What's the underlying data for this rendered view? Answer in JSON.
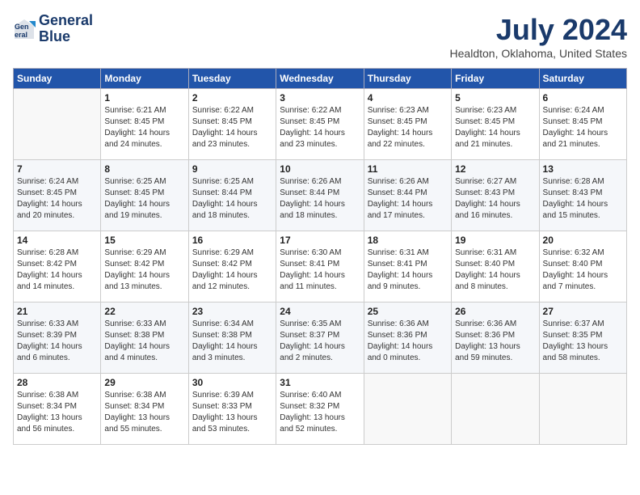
{
  "logo": {
    "line1": "General",
    "line2": "Blue"
  },
  "title": "July 2024",
  "location": "Healdton, Oklahoma, United States",
  "weekdays": [
    "Sunday",
    "Monday",
    "Tuesday",
    "Wednesday",
    "Thursday",
    "Friday",
    "Saturday"
  ],
  "weeks": [
    [
      {
        "day": "",
        "empty": true
      },
      {
        "day": "1",
        "sunrise": "Sunrise: 6:21 AM",
        "sunset": "Sunset: 8:45 PM",
        "daylight": "Daylight: 14 hours and 24 minutes."
      },
      {
        "day": "2",
        "sunrise": "Sunrise: 6:22 AM",
        "sunset": "Sunset: 8:45 PM",
        "daylight": "Daylight: 14 hours and 23 minutes."
      },
      {
        "day": "3",
        "sunrise": "Sunrise: 6:22 AM",
        "sunset": "Sunset: 8:45 PM",
        "daylight": "Daylight: 14 hours and 23 minutes."
      },
      {
        "day": "4",
        "sunrise": "Sunrise: 6:23 AM",
        "sunset": "Sunset: 8:45 PM",
        "daylight": "Daylight: 14 hours and 22 minutes."
      },
      {
        "day": "5",
        "sunrise": "Sunrise: 6:23 AM",
        "sunset": "Sunset: 8:45 PM",
        "daylight": "Daylight: 14 hours and 21 minutes."
      },
      {
        "day": "6",
        "sunrise": "Sunrise: 6:24 AM",
        "sunset": "Sunset: 8:45 PM",
        "daylight": "Daylight: 14 hours and 21 minutes."
      }
    ],
    [
      {
        "day": "7",
        "sunrise": "Sunrise: 6:24 AM",
        "sunset": "Sunset: 8:45 PM",
        "daylight": "Daylight: 14 hours and 20 minutes."
      },
      {
        "day": "8",
        "sunrise": "Sunrise: 6:25 AM",
        "sunset": "Sunset: 8:45 PM",
        "daylight": "Daylight: 14 hours and 19 minutes."
      },
      {
        "day": "9",
        "sunrise": "Sunrise: 6:25 AM",
        "sunset": "Sunset: 8:44 PM",
        "daylight": "Daylight: 14 hours and 18 minutes."
      },
      {
        "day": "10",
        "sunrise": "Sunrise: 6:26 AM",
        "sunset": "Sunset: 8:44 PM",
        "daylight": "Daylight: 14 hours and 18 minutes."
      },
      {
        "day": "11",
        "sunrise": "Sunrise: 6:26 AM",
        "sunset": "Sunset: 8:44 PM",
        "daylight": "Daylight: 14 hours and 17 minutes."
      },
      {
        "day": "12",
        "sunrise": "Sunrise: 6:27 AM",
        "sunset": "Sunset: 8:43 PM",
        "daylight": "Daylight: 14 hours and 16 minutes."
      },
      {
        "day": "13",
        "sunrise": "Sunrise: 6:28 AM",
        "sunset": "Sunset: 8:43 PM",
        "daylight": "Daylight: 14 hours and 15 minutes."
      }
    ],
    [
      {
        "day": "14",
        "sunrise": "Sunrise: 6:28 AM",
        "sunset": "Sunset: 8:42 PM",
        "daylight": "Daylight: 14 hours and 14 minutes."
      },
      {
        "day": "15",
        "sunrise": "Sunrise: 6:29 AM",
        "sunset": "Sunset: 8:42 PM",
        "daylight": "Daylight: 14 hours and 13 minutes."
      },
      {
        "day": "16",
        "sunrise": "Sunrise: 6:29 AM",
        "sunset": "Sunset: 8:42 PM",
        "daylight": "Daylight: 14 hours and 12 minutes."
      },
      {
        "day": "17",
        "sunrise": "Sunrise: 6:30 AM",
        "sunset": "Sunset: 8:41 PM",
        "daylight": "Daylight: 14 hours and 11 minutes."
      },
      {
        "day": "18",
        "sunrise": "Sunrise: 6:31 AM",
        "sunset": "Sunset: 8:41 PM",
        "daylight": "Daylight: 14 hours and 9 minutes."
      },
      {
        "day": "19",
        "sunrise": "Sunrise: 6:31 AM",
        "sunset": "Sunset: 8:40 PM",
        "daylight": "Daylight: 14 hours and 8 minutes."
      },
      {
        "day": "20",
        "sunrise": "Sunrise: 6:32 AM",
        "sunset": "Sunset: 8:40 PM",
        "daylight": "Daylight: 14 hours and 7 minutes."
      }
    ],
    [
      {
        "day": "21",
        "sunrise": "Sunrise: 6:33 AM",
        "sunset": "Sunset: 8:39 PM",
        "daylight": "Daylight: 14 hours and 6 minutes."
      },
      {
        "day": "22",
        "sunrise": "Sunrise: 6:33 AM",
        "sunset": "Sunset: 8:38 PM",
        "daylight": "Daylight: 14 hours and 4 minutes."
      },
      {
        "day": "23",
        "sunrise": "Sunrise: 6:34 AM",
        "sunset": "Sunset: 8:38 PM",
        "daylight": "Daylight: 14 hours and 3 minutes."
      },
      {
        "day": "24",
        "sunrise": "Sunrise: 6:35 AM",
        "sunset": "Sunset: 8:37 PM",
        "daylight": "Daylight: 14 hours and 2 minutes."
      },
      {
        "day": "25",
        "sunrise": "Sunrise: 6:36 AM",
        "sunset": "Sunset: 8:36 PM",
        "daylight": "Daylight: 14 hours and 0 minutes."
      },
      {
        "day": "26",
        "sunrise": "Sunrise: 6:36 AM",
        "sunset": "Sunset: 8:36 PM",
        "daylight": "Daylight: 13 hours and 59 minutes."
      },
      {
        "day": "27",
        "sunrise": "Sunrise: 6:37 AM",
        "sunset": "Sunset: 8:35 PM",
        "daylight": "Daylight: 13 hours and 58 minutes."
      }
    ],
    [
      {
        "day": "28",
        "sunrise": "Sunrise: 6:38 AM",
        "sunset": "Sunset: 8:34 PM",
        "daylight": "Daylight: 13 hours and 56 minutes."
      },
      {
        "day": "29",
        "sunrise": "Sunrise: 6:38 AM",
        "sunset": "Sunset: 8:34 PM",
        "daylight": "Daylight: 13 hours and 55 minutes."
      },
      {
        "day": "30",
        "sunrise": "Sunrise: 6:39 AM",
        "sunset": "Sunset: 8:33 PM",
        "daylight": "Daylight: 13 hours and 53 minutes."
      },
      {
        "day": "31",
        "sunrise": "Sunrise: 6:40 AM",
        "sunset": "Sunset: 8:32 PM",
        "daylight": "Daylight: 13 hours and 52 minutes."
      },
      {
        "day": "",
        "empty": true
      },
      {
        "day": "",
        "empty": true
      },
      {
        "day": "",
        "empty": true
      }
    ]
  ]
}
